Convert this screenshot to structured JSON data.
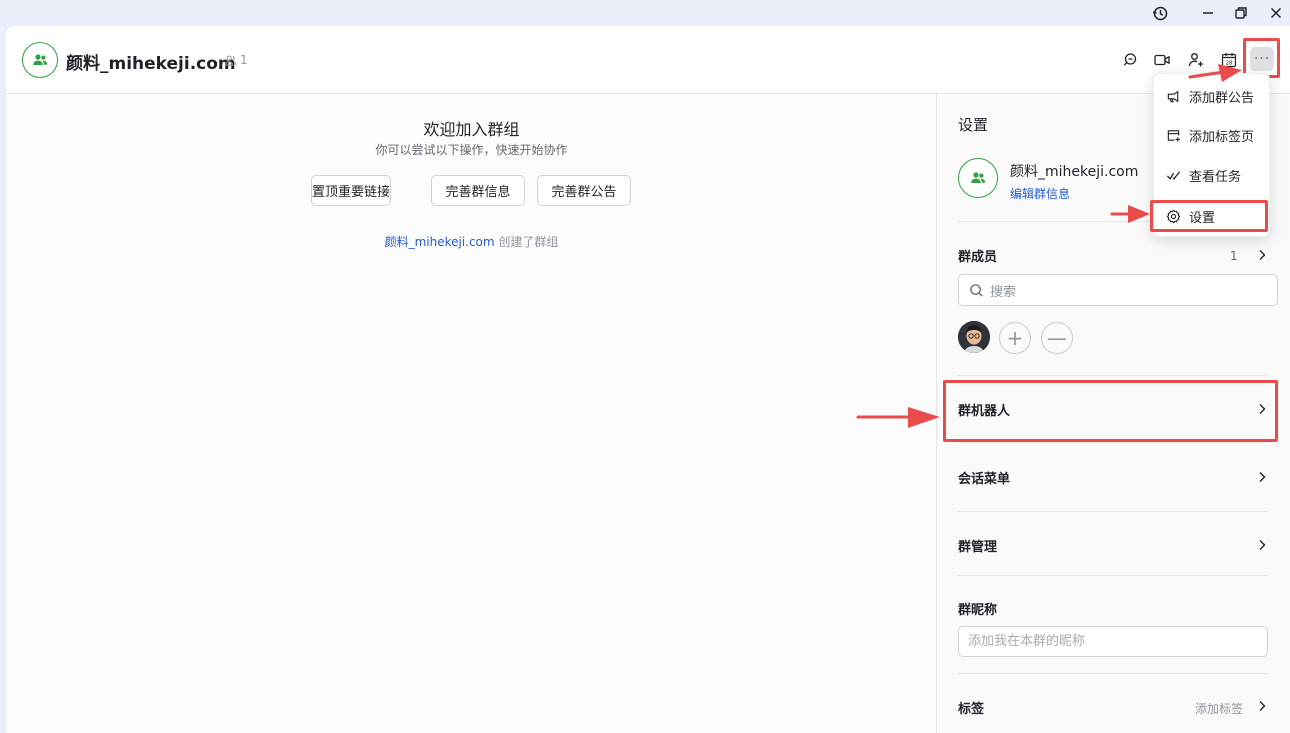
{
  "header": {
    "group_name": "颜料_mihekeji.com",
    "member_count": "1",
    "more_label": "···"
  },
  "main": {
    "welcome_title": "欢迎加入群组",
    "welcome_subtitle": "你可以尝试以下操作，快速开始协作",
    "actions": [
      "置顶重要链接",
      "完善群信息",
      "完善群公告"
    ],
    "creator": "颜料_mihekeji.com",
    "created_text": " 创建了群组"
  },
  "menu": {
    "items": [
      {
        "label": "添加群公告",
        "icon": "announcement-icon"
      },
      {
        "label": "添加标签页",
        "icon": "add-tab-icon"
      },
      {
        "label": "查看任务",
        "icon": "task-check-icon"
      },
      {
        "label": "设置",
        "icon": "gear-icon"
      }
    ]
  },
  "side": {
    "title": "设置",
    "group_name": "颜料_mihekeji.com",
    "edit_link": "编辑群信息",
    "members_label": "群成员",
    "members_count": "1",
    "search_placeholder": "搜索",
    "bots_label": "群机器人",
    "chat_menu_label": "会话菜单",
    "manage_label": "群管理",
    "nickname_label": "群昵称",
    "nickname_placeholder": "添加我在本群的昵称",
    "tags_label": "标签",
    "tags_add": "添加标签"
  },
  "colors": {
    "accent_green": "#2ea043",
    "link_blue": "#245bdb",
    "highlight_red": "#ea4b4b"
  }
}
